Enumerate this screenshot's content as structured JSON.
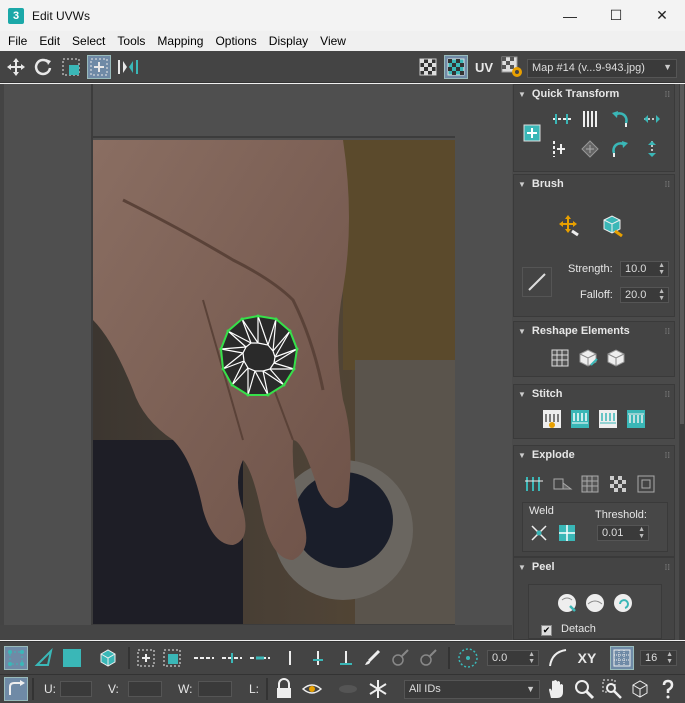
{
  "window": {
    "title": "Edit UVWs",
    "app_icon_label": "3",
    "controls": {
      "minimize": "—",
      "maximize": "☐",
      "close": "✕"
    }
  },
  "menu": [
    "File",
    "Edit",
    "Select",
    "Tools",
    "Mapping",
    "Options",
    "Display",
    "View"
  ],
  "toolbar_top": {
    "uv_label": "UV",
    "map_select": "Map #14 (v...9-943.jpg)"
  },
  "panel": {
    "quick_transform": {
      "title": "Quick Transform"
    },
    "brush": {
      "title": "Brush",
      "strength_label": "Strength:",
      "strength_value": "10.0",
      "falloff_label": "Falloff:",
      "falloff_value": "20.0"
    },
    "reshape": {
      "title": "Reshape Elements"
    },
    "stitch": {
      "title": "Stitch"
    },
    "explode": {
      "title": "Explode",
      "weld_label": "Weld",
      "threshold_label": "Threshold:",
      "threshold_value": "0.01"
    },
    "peel": {
      "title": "Peel",
      "detach_label": "Detach",
      "detach_checked": true
    }
  },
  "toolbar_bottom1": {
    "rotation_value": "0.0",
    "xy_label": "XY",
    "grid_value": "16"
  },
  "toolbar_bottom2": {
    "u_label": "U:",
    "v_label": "V:",
    "w_label": "W:",
    "l_label": "L:",
    "ids_select": "All IDs"
  },
  "colors": {
    "accent_teal": "#3ab7b7",
    "selection_green": "#36e04a",
    "panel_bg": "#4a4a4a",
    "toolbar_bg": "#444444"
  }
}
